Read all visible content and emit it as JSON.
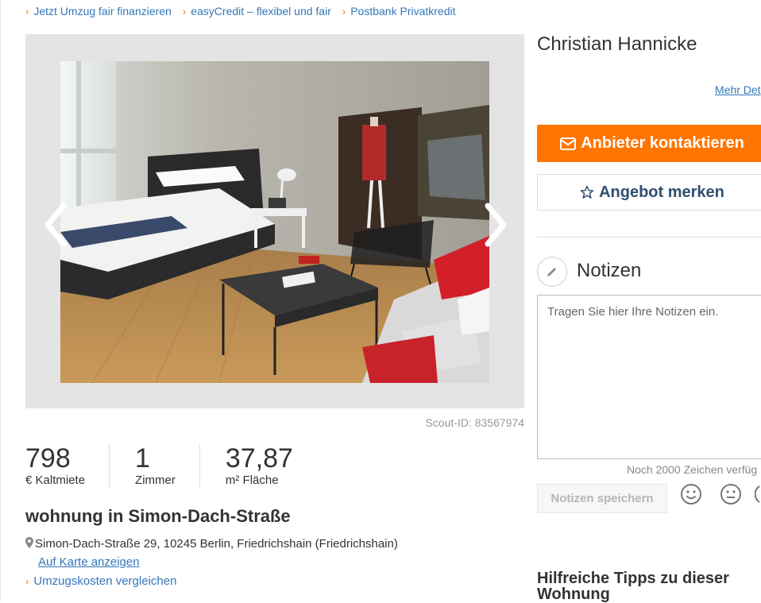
{
  "top_links": [
    {
      "label": "Jetzt Umzug fair finanzieren"
    },
    {
      "label": "easyCredit – flexibel und fair"
    },
    {
      "label": "Postbank Privatkredit"
    }
  ],
  "gallery": {
    "scout_id": "Scout-ID: 83567974"
  },
  "facts": [
    {
      "value": "798",
      "label": "€ Kaltmiete"
    },
    {
      "value": "1",
      "label": "Zimmer"
    },
    {
      "value": "37,87",
      "label": "m² Fläche"
    }
  ],
  "listing": {
    "title": "wohnung in Simon-Dach-Straße",
    "address": "Simon-Dach-Straße 29, 10245 Berlin, Friedrichshain (Friedrichshain)",
    "map_link": "Auf Karte anzeigen",
    "moving_costs_link": "Umzugskosten vergleichen"
  },
  "contact": {
    "name": "Christian Hannicke",
    "more_details": "Mehr Det",
    "contact_button": "Anbieter kontaktieren",
    "save_offer_button": "Angebot merken"
  },
  "notes": {
    "heading": "Notizen",
    "placeholder": "Tragen Sie hier Ihre Notizen ein.",
    "remaining": "Noch 2000 Zeichen verfüg",
    "save_button": "Notizen speichern"
  },
  "tips": {
    "heading": "Hilfreiche Tipps zu dieser Wohnung"
  },
  "colors": {
    "accent": "#ff7500",
    "link": "#3277b8"
  }
}
